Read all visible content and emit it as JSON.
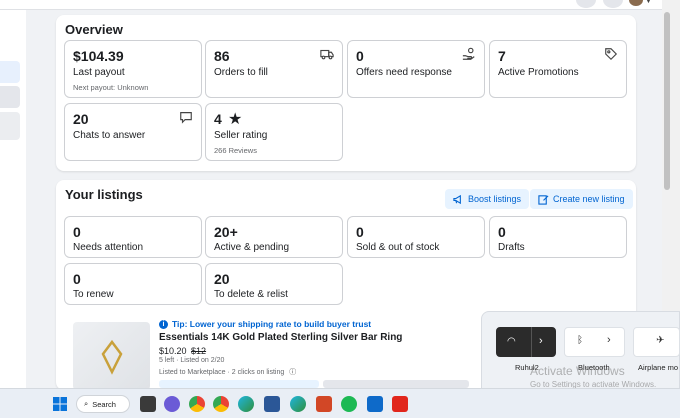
{
  "overview": {
    "title": "Overview",
    "cards": [
      {
        "value": "$104.39",
        "label": "Last payout",
        "sub": "Next payout: Unknown",
        "icon": "none"
      },
      {
        "value": "86",
        "label": "Orders to fill",
        "icon": "truck-icon"
      },
      {
        "value": "0",
        "label": "Offers need response",
        "icon": "hand-money-icon"
      },
      {
        "value": "7",
        "label": "Active Promotions",
        "icon": "tag-icon"
      },
      {
        "value": "20",
        "label": "Chats to answer",
        "icon": "chat-icon"
      },
      {
        "value": "4",
        "label": "Seller rating",
        "sub": "266 Reviews",
        "icon": "star-icon"
      }
    ]
  },
  "listings": {
    "title": "Your listings",
    "boost_label": "Boost listings",
    "create_label": "Create new listing",
    "cards": [
      {
        "value": "0",
        "label": "Needs attention"
      },
      {
        "value": "20+",
        "label": "Active & pending"
      },
      {
        "value": "0",
        "label": "Sold & out of stock"
      },
      {
        "value": "0",
        "label": "Drafts"
      },
      {
        "value": "0",
        "label": "To renew"
      },
      {
        "value": "20",
        "label": "To delete & relist"
      }
    ],
    "item": {
      "tip": "Tip: Lower your shipping rate to build buyer trust",
      "title": "Essentials 14K Gold Plated Sterling Silver Bar Ring",
      "price": "$10.20",
      "old_price": "$12",
      "stock": "5 left · Listed on 2/20",
      "listed_on": "Listed to Marketplace · 2 clicks on listing"
    }
  },
  "taskbar": {
    "search_label": "Search",
    "apps": [
      "windows-icon",
      "search-icon",
      "task-view-icon",
      "chat-app-icon",
      "chrome-icon",
      "chrome-icon",
      "edge-icon",
      "word-icon",
      "outlook-icon",
      "edge-icon",
      "powerpoint-icon",
      "spotify-icon",
      "store-icon",
      "teamviewer-icon",
      "anydesk-icon"
    ]
  },
  "quick_settings": {
    "wifi_label": "Ruhul2",
    "bluetooth_label": "Bluetooth",
    "airplane_label": "Airplane mo"
  },
  "activation": {
    "line1": "Activate Windows",
    "line2": "Go to Settings to activate Windows."
  }
}
